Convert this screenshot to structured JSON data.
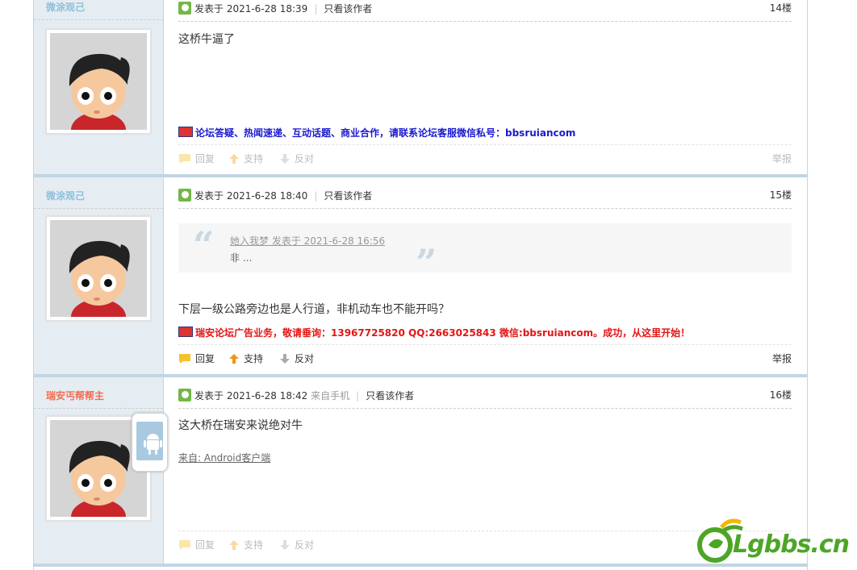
{
  "posts": [
    {
      "username": "微涂观己",
      "date_line": "发表于 2021-6-28 18:39",
      "only_author": "只看该作者",
      "floor": "14楼",
      "message": "这桥牛逼了",
      "ad": "论坛答疑、热闻速递、互动话题、商业合作，请联系论坛客服微信私号：bbsruiancom",
      "actions": {
        "reply": "回复",
        "support": "支持",
        "oppose": "反对",
        "report": "举报"
      }
    },
    {
      "username": "微涂观己",
      "date_line": "发表于 2021-6-28 18:40",
      "only_author": "只看该作者",
      "floor": "15楼",
      "quote_header": "她入我梦 发表于 2021-6-28 16:56",
      "quote_body": "非 ...",
      "message": "下层一级公路旁边也是人行道，非机动车也不能开吗？",
      "ad": "瑞安论坛广告业务，敬请垂询：13967725820 QQ:2663025843 微信:bbsruiancom。成功，从这里开始！",
      "actions": {
        "reply": "回复",
        "support": "支持",
        "oppose": "反对",
        "report": "举报"
      }
    },
    {
      "username": "瑞安丐帮帮主",
      "date_line": "发表于 2021-6-28 18:42",
      "from_mobile": "来自手机",
      "only_author": "只看该作者",
      "floor": "16楼",
      "message": "这大桥在瑞安来说绝对牛",
      "source": "来自: Android客户端",
      "actions": {
        "reply": "回复",
        "support": "支持",
        "oppose": "反对",
        "report": ""
      }
    }
  ],
  "watermark": "Lgbbs.cn",
  "colors": {
    "border": "#c2d5e3",
    "sidebar": "#e5edf2",
    "username": "#8ec0d8",
    "username_alt": "#f26c4f",
    "ad_blue": "#1b1bcf",
    "ad_red": "#e31515"
  }
}
